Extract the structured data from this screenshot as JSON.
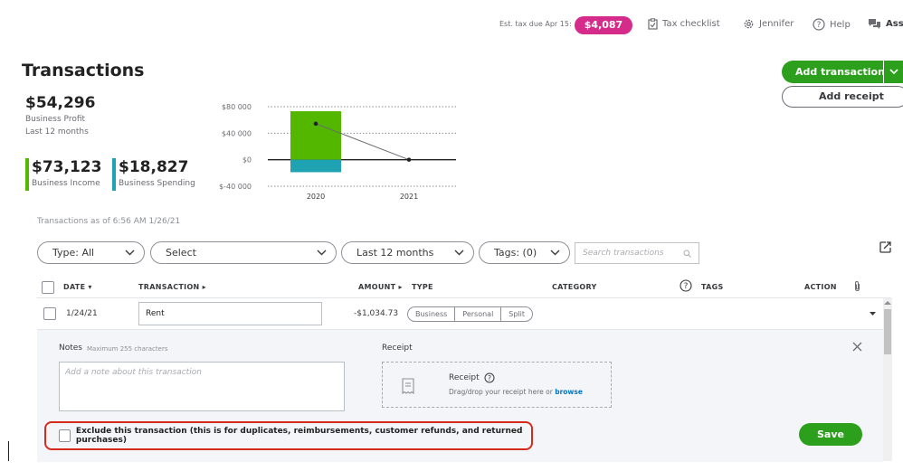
{
  "topbar": {
    "est_tax_label": "Est. tax due Apr 15:",
    "est_tax_amount": "$4,087",
    "tax_checklist": "Tax checklist",
    "user": "Jennifer",
    "help": "Help",
    "assistant": "Assi"
  },
  "page": {
    "title": "Transactions"
  },
  "actions": {
    "add_transaction": "Add transaction",
    "add_receipt": "Add receipt"
  },
  "summary": {
    "profit": {
      "value": "$54,296",
      "label": "Business Profit",
      "period": "Last 12 months"
    },
    "income": {
      "value": "$73,123",
      "label": "Business Income"
    },
    "spending": {
      "value": "$18,827",
      "label": "Business Spending"
    }
  },
  "colors": {
    "income": "#53b700",
    "spending": "#1fa3b3",
    "accent": "#2ca01c",
    "tax_pill": "#d52b8a",
    "highlight": "#d52b1e"
  },
  "chart_data": {
    "type": "bar",
    "categories": [
      "2020",
      "2021"
    ],
    "series": [
      {
        "values": [
          73123,
          0
        ]
      },
      {
        "values": [
          -18827,
          0
        ]
      }
    ],
    "line": {
      "values": [
        54296,
        0
      ]
    },
    "yticks": [
      "$80 000",
      "$40 000",
      "$0",
      "$-40 000"
    ],
    "ylim": [
      -40000,
      80000
    ]
  },
  "as_of": "Transactions as of 6:56 AM 1/26/21",
  "filters": {
    "type": "Type: All",
    "select": "Select",
    "period": "Last 12 months",
    "tags": "Tags: (0)",
    "search_placeholder": "Search transactions"
  },
  "table": {
    "headers": {
      "date": "DATE ▾",
      "transaction": "TRANSACTION ▸",
      "amount": "AMOUNT ▸",
      "type": "TYPE",
      "category": "CATEGORY",
      "tags": "TAGS",
      "action": "ACTION"
    },
    "rows": [
      {
        "date": "1/24/21",
        "transaction": "Rent",
        "amount": "-$1,034.73",
        "types": [
          "Business",
          "Personal",
          "Split"
        ]
      }
    ]
  },
  "detail": {
    "notes_label": "Notes",
    "notes_hint": "Maximum 255 characters",
    "notes_placeholder": "Add a note about this transaction",
    "receipt_label": "Receipt",
    "receipt_title": "Receipt",
    "receipt_hint": "Drag/drop your receipt here or",
    "browse": "browse",
    "exclude_label": "Exclude this transaction (this is for duplicates, reimbursements, customer refunds, and returned purchases)",
    "save": "Save"
  }
}
